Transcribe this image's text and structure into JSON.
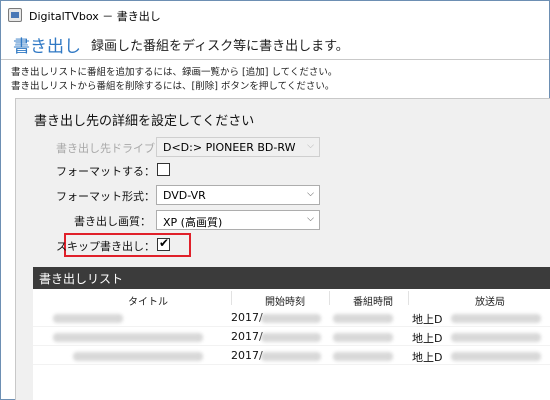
{
  "window": {
    "title": "DigitalTVbox － 書き出し"
  },
  "header": {
    "title": "書き出し",
    "description": "録画した番組をディスク等に書き出します。"
  },
  "instructions": [
    "書き出しリストに番組を追加するには、録画一覧から [追加] してください。",
    "書き出しリストから番組を削除するには、[削除] ボタンを押してください。"
  ],
  "settings": {
    "section_title": "書き出し先の詳細を設定してください",
    "drive_label": "書き出し先ドライブ：",
    "drive_value": "D<D:> PIONEER BD-RW",
    "format_label": "フォーマットする：",
    "format_checked": false,
    "format_type_label": "フォーマット形式：",
    "format_type_value": "DVD-VR",
    "quality_label": "書き出し画質：",
    "quality_value": "XP (高画質)",
    "skip_label": "スキップ書き出し：",
    "skip_checked": true
  },
  "list": {
    "title": "書き出しリスト",
    "columns": [
      "タイトル",
      "開始時刻",
      "番組時間",
      "放送局"
    ],
    "rows": [
      {
        "start": "2017/",
        "channel": "地上D"
      },
      {
        "start": "2017/",
        "channel": "地上D"
      },
      {
        "start": "2017/",
        "channel": "地上D"
      }
    ]
  },
  "icons": {
    "dropdown": "chevron-down-icon",
    "check": "check-mark-icon"
  },
  "colors": {
    "accent": "#2f78c4",
    "highlight_border": "#e0202a",
    "list_header_bg": "#3b3b3b"
  }
}
